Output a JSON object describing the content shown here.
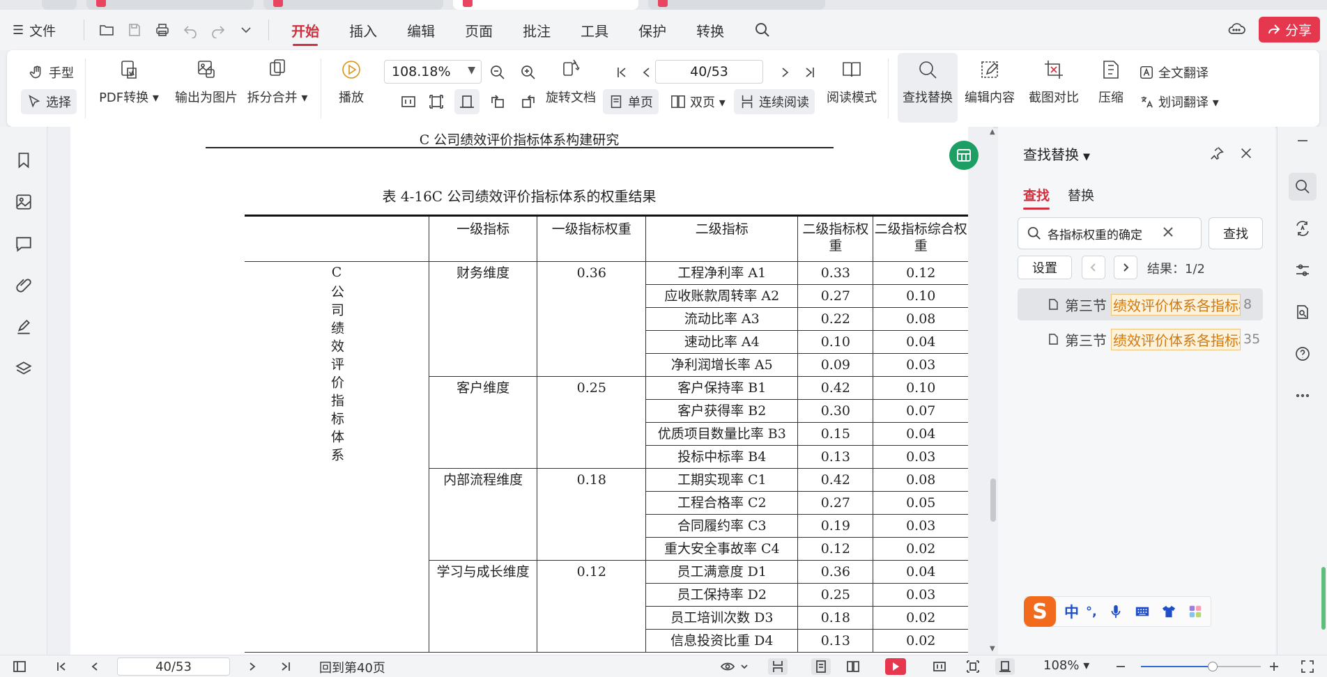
{
  "menubar": {
    "file_label": "文件",
    "menus": [
      "开始",
      "插入",
      "编辑",
      "页面",
      "批注",
      "工具",
      "保护",
      "转换"
    ],
    "active_menu": "开始",
    "share_label": "分享"
  },
  "ribbon": {
    "hand_label": "手型",
    "select_label": "选择",
    "pdf_convert_label": "PDF转换",
    "export_image_label": "输出为图片",
    "split_merge_label": "拆分合并",
    "play_label": "播放",
    "zoom_value": "108.18%",
    "page_value": "40/53",
    "rotate_label": "旋转文档",
    "single_page_label": "单页",
    "double_page_label": "双页",
    "continuous_label": "连续阅读",
    "read_mode_label": "阅读模式",
    "find_replace_label": "查找替换",
    "edit_content_label": "编辑内容",
    "screenshot_compare_label": "截图对比",
    "compress_label": "压缩",
    "full_translate_label": "全文翻译",
    "word_translate_label": "划词翻译"
  },
  "document": {
    "running_header": "C 公司绩效评价指标体系构建研究",
    "table_caption": "表 4-16C 公司绩效评价指标体系的权重结果",
    "headers": [
      "",
      "一级指标",
      "一级指标权重",
      "二级指标",
      "二级指标权重",
      "二级指标综合权重"
    ],
    "system_label": "C公司绩效评价指标体系",
    "groups": [
      {
        "name": "财务维度",
        "weight": "0.36",
        "rows": [
          {
            "indicator": "工程净利率 A1",
            "weight": "0.33",
            "combined": "0.12"
          },
          {
            "indicator": "应收账款周转率 A2",
            "weight": "0.27",
            "combined": "0.10"
          },
          {
            "indicator": "流动比率 A3",
            "weight": "0.22",
            "combined": "0.08"
          },
          {
            "indicator": "速动比率 A4",
            "weight": "0.10",
            "combined": "0.04"
          },
          {
            "indicator": "净利润增长率 A5",
            "weight": "0.09",
            "combined": "0.03"
          }
        ]
      },
      {
        "name": "客户维度",
        "weight": "0.25",
        "rows": [
          {
            "indicator": "客户保持率 B1",
            "weight": "0.42",
            "combined": "0.10"
          },
          {
            "indicator": "客户获得率 B2",
            "weight": "0.30",
            "combined": "0.07"
          },
          {
            "indicator": "优质项目数量比率 B3",
            "weight": "0.15",
            "combined": "0.04"
          },
          {
            "indicator": "投标中标率 B4",
            "weight": "0.13",
            "combined": "0.03"
          }
        ]
      },
      {
        "name": "内部流程维度",
        "weight": "0.18",
        "rows": [
          {
            "indicator": "工期实现率 C1",
            "weight": "0.42",
            "combined": "0.08"
          },
          {
            "indicator": "工程合格率 C2",
            "weight": "0.27",
            "combined": "0.05"
          },
          {
            "indicator": "合同履约率 C3",
            "weight": "0.19",
            "combined": "0.03"
          },
          {
            "indicator": "重大安全事故率 C4",
            "weight": "0.12",
            "combined": "0.02"
          }
        ]
      },
      {
        "name": "学习与成长维度",
        "weight": "0.12",
        "rows": [
          {
            "indicator": "员工满意度 D1",
            "weight": "0.36",
            "combined": "0.04"
          },
          {
            "indicator": "员工保持率 D2",
            "weight": "0.25",
            "combined": "0.03"
          },
          {
            "indicator": "员工培训次数 D3",
            "weight": "0.18",
            "combined": "0.02"
          },
          {
            "indicator": "信息投资比重 D4",
            "weight": "0.13",
            "combined": "0.02"
          }
        ]
      }
    ]
  },
  "find_panel": {
    "title": "查找替换",
    "tab_find": "查找",
    "tab_replace": "替换",
    "search_value": "各指标权重的确定",
    "find_button": "查找",
    "settings_button": "设置",
    "result_text": "结果：1/2",
    "results": [
      {
        "section": "第三节",
        "match": "绩效评价体系各指标权重的确定",
        "page": "8"
      },
      {
        "section": "第三节",
        "match": "绩效评价体系各指标权重的确定",
        "page": "35"
      }
    ]
  },
  "ime": {
    "logo": "S",
    "mode": "中",
    "punct": "°,"
  },
  "statusbar": {
    "page_value": "40/53",
    "back_label": "回到第40页",
    "zoom_text": "108%",
    "zoom_fraction": 0.6
  },
  "colors": {
    "accent": "#d0303d",
    "share": "#e5384f",
    "badge": "#1d9e62"
  }
}
